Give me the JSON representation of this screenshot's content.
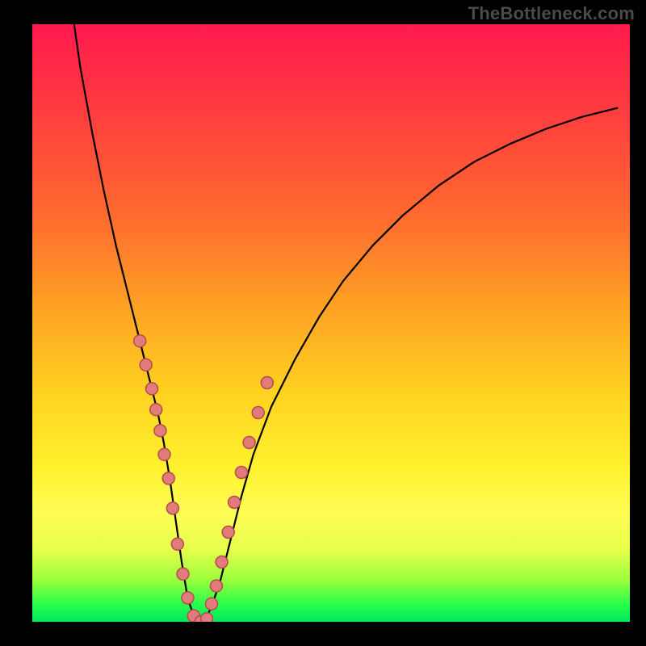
{
  "watermark": {
    "text": "TheBottleneck.com"
  },
  "chart_data": {
    "type": "line",
    "title": "",
    "xlabel": "",
    "ylabel": "",
    "xlim": [
      0,
      100
    ],
    "ylim": [
      0,
      100
    ],
    "series": [
      {
        "name": "curve",
        "x": [
          7,
          8,
          10,
          12,
          14,
          16,
          18,
          19,
          20,
          21,
          22,
          23,
          24,
          25,
          26,
          27,
          28,
          29,
          30,
          31.5,
          33,
          35,
          37,
          40,
          44,
          48,
          52,
          57,
          62,
          68,
          74,
          80,
          86,
          92,
          98
        ],
        "values": [
          100,
          93,
          82,
          72,
          63,
          55,
          47,
          43,
          39,
          35,
          30,
          24,
          17,
          10,
          4,
          1,
          0,
          0.5,
          2.5,
          7,
          13,
          21,
          28,
          36,
          44,
          51,
          57,
          63,
          68,
          73,
          77,
          80,
          82.5,
          84.5,
          86
        ]
      },
      {
        "name": "dots",
        "x": [
          18,
          19,
          20,
          20.7,
          21.4,
          22.1,
          22.8,
          23.5,
          24.3,
          25.2,
          26,
          27,
          28.2,
          29.2,
          30,
          30.8,
          31.7,
          32.8,
          33.8,
          35,
          36.3,
          37.8,
          39.3
        ],
        "values": [
          47,
          43,
          39,
          35.5,
          32,
          28,
          24,
          19,
          13,
          8,
          4,
          1,
          0,
          0.5,
          3,
          6,
          10,
          15,
          20,
          25,
          30,
          35,
          40
        ]
      }
    ],
    "colors": {
      "curve": "#000000",
      "dots_fill": "#e27b7b",
      "dots_stroke": "#b74b4b"
    },
    "grid": false,
    "legend": false
  }
}
